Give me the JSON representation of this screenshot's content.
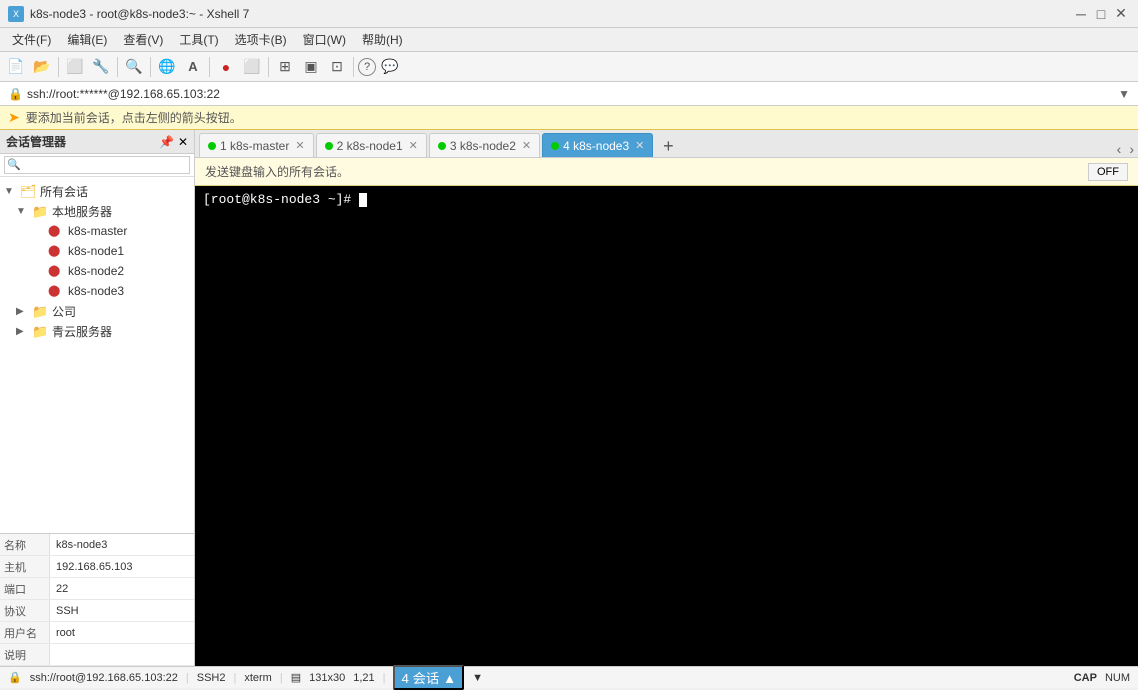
{
  "title": {
    "text": "k8s-node3 - root@k8s-node3:~ - Xshell 7",
    "icon": "X"
  },
  "menu": {
    "items": [
      "文件(F)",
      "编辑(E)",
      "查看(V)",
      "工具(T)",
      "选项卡(B)",
      "窗口(W)",
      "帮助(H)"
    ]
  },
  "address_bar": {
    "text": "ssh://root:******@192.168.65.103:22"
  },
  "notification": {
    "text": "要添加当前会话，点击左侧的箭头按钮。"
  },
  "sidebar": {
    "title": "会话管理器",
    "tree": [
      {
        "level": 0,
        "label": "所有会话",
        "type": "root",
        "expanded": true
      },
      {
        "level": 1,
        "label": "本地服务器",
        "type": "folder",
        "expanded": true
      },
      {
        "level": 2,
        "label": "k8s-master",
        "type": "server"
      },
      {
        "level": 2,
        "label": "k8s-node1",
        "type": "server"
      },
      {
        "level": 2,
        "label": "k8s-node2",
        "type": "server"
      },
      {
        "level": 2,
        "label": "k8s-node3",
        "type": "server"
      },
      {
        "level": 1,
        "label": "公司",
        "type": "folder",
        "expanded": false
      },
      {
        "level": 1,
        "label": "青云服务器",
        "type": "folder",
        "expanded": false
      }
    ],
    "properties": [
      {
        "key": "名称",
        "val": "k8s-node3"
      },
      {
        "key": "主机",
        "val": "192.168.65.103"
      },
      {
        "key": "端口",
        "val": "22"
      },
      {
        "key": "协议",
        "val": "SSH"
      },
      {
        "key": "用户名",
        "val": "root"
      },
      {
        "key": "说明",
        "val": ""
      }
    ]
  },
  "tabs": [
    {
      "id": 1,
      "label": "1 k8s-master",
      "active": false,
      "dot": true
    },
    {
      "id": 2,
      "label": "2 k8s-node1",
      "active": false,
      "dot": true
    },
    {
      "id": 3,
      "label": "3 k8s-node2",
      "active": false,
      "dot": true
    },
    {
      "id": 4,
      "label": "4 k8s-node3",
      "active": true,
      "dot": true
    }
  ],
  "send_to_all": {
    "text": "发送键盘输入的所有会话。",
    "button": "OFF"
  },
  "terminal": {
    "prompt": "[root@k8s-node3 ~]# "
  },
  "status_bar": {
    "address": "ssh://root@192.168.65.103:22",
    "protocol": "SSH2",
    "term": "xterm",
    "size": "131x30",
    "cursor": "1,21",
    "sessions": "4 会话",
    "sessions_btn_suffix": "▲",
    "cap": "CAP",
    "num": "NUM"
  }
}
